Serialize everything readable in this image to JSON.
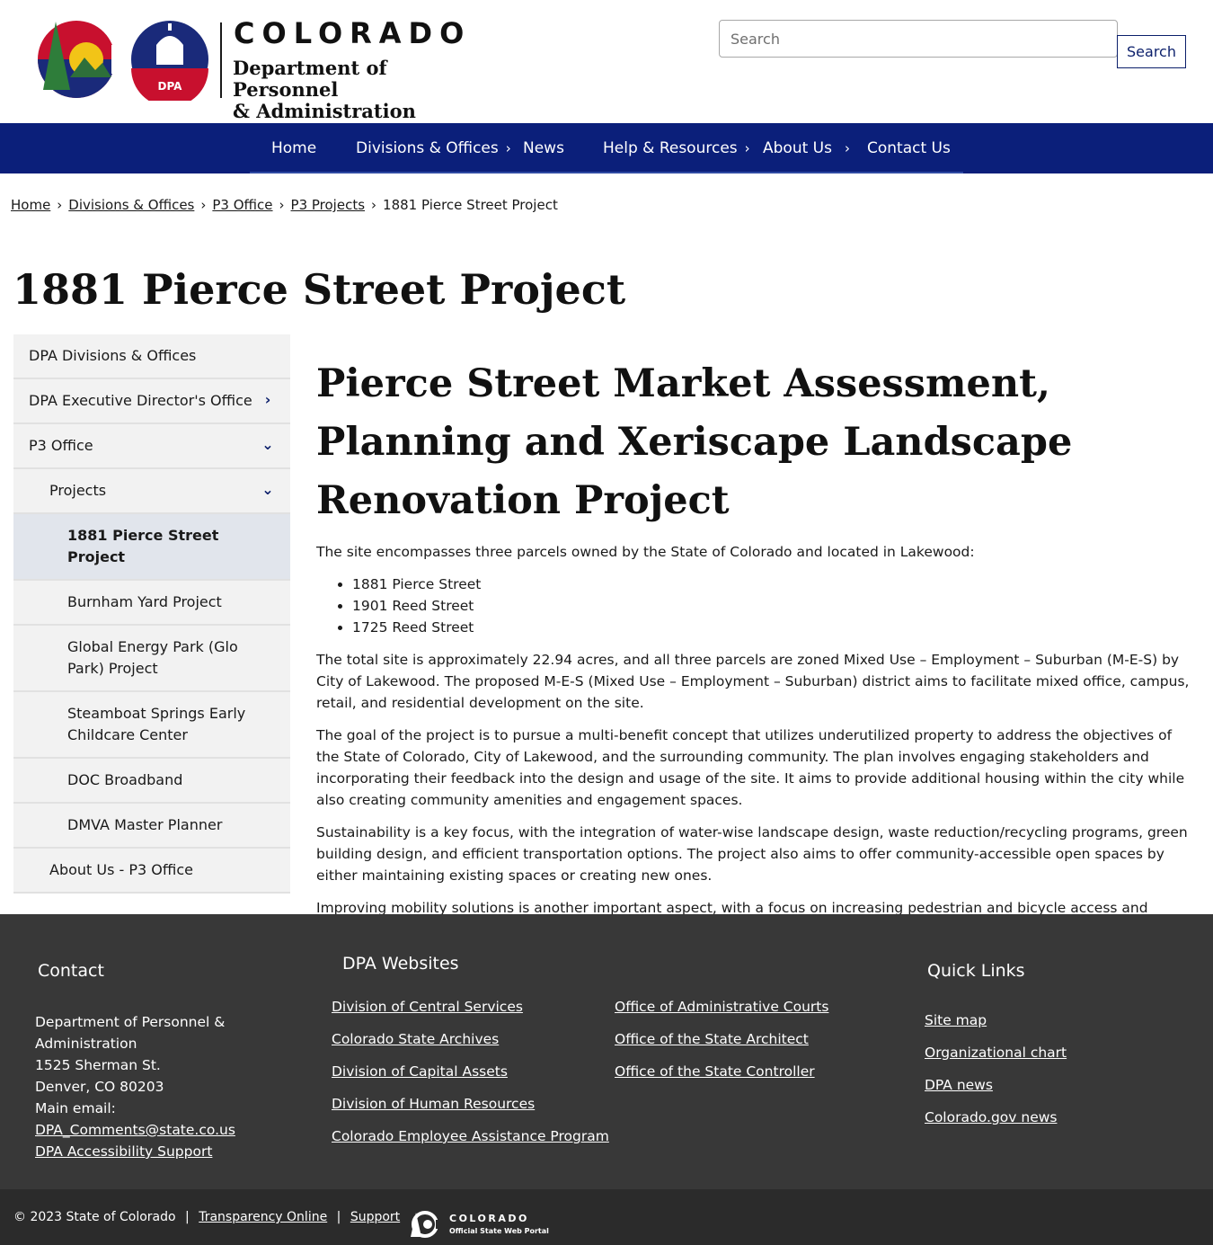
{
  "header": {
    "logo_colorado": "COLORADO",
    "logo_dept_line1": "Department of Personnel",
    "logo_dept_line2": "& Administration",
    "logo_badge": "DPA",
    "search_placeholder": "Search",
    "search_button": "Search"
  },
  "nav": {
    "items": [
      {
        "label": "Home",
        "has_chevron": false
      },
      {
        "label": "Divisions & Offices",
        "has_chevron": true
      },
      {
        "label": "News",
        "has_chevron": false
      },
      {
        "label": "Help & Resources",
        "has_chevron": true
      },
      {
        "label": "About Us",
        "has_chevron": true
      },
      {
        "label": "Contact Us",
        "has_chevron": false
      }
    ],
    "chevron": "›"
  },
  "breadcrumb": {
    "items": [
      "Home",
      "Divisions & Offices",
      "P3 Office",
      "P3 Projects"
    ],
    "current": "1881 Pierce Street Project",
    "separator": "›"
  },
  "page_title": "1881 Pierce Street Project",
  "sidebar": {
    "items": [
      {
        "label": "DPA Divisions & Offices",
        "chevron": ""
      },
      {
        "label": "DPA Executive Director's Office",
        "chevron": "right"
      },
      {
        "label": "P3 Office",
        "chevron": "down"
      },
      {
        "label": "Projects",
        "chevron": "down"
      },
      {
        "label": "1881 Pierce Street Project",
        "chevron": ""
      },
      {
        "label": "Burnham Yard Project",
        "chevron": ""
      },
      {
        "label": "Global Energy Park (Glo Park) Project",
        "chevron": ""
      },
      {
        "label": "Steamboat Springs Early Childcare Center",
        "chevron": ""
      },
      {
        "label": "DOC Broadband",
        "chevron": ""
      },
      {
        "label": "DMVA Master Planner",
        "chevron": ""
      },
      {
        "label": "About Us - P3 Office",
        "chevron": ""
      }
    ]
  },
  "main": {
    "heading": "Pierce Street Market Assessment, Planning and Xeriscape Landscape Renovation Project",
    "intro": "The site encompasses three parcels owned by the State of Colorado and located in Lakewood:",
    "parcels": [
      "1881 Pierce Street",
      "1901 Reed Street",
      "1725 Reed Street"
    ],
    "paragraphs": [
      "The total site is approximately 22.94 acres, and all three parcels are zoned Mixed Use – Employment – Suburban (M-E-S) by City of Lakewood. The proposed M-E-S (Mixed Use – Employment – Suburban) district aims to facilitate mixed office, campus, retail, and residential development on the site.",
      "The goal of the project is to pursue a multi-benefit concept that utilizes underutilized property to address the objectives of the State of Colorado, City of Lakewood, and the surrounding community. The plan involves engaging stakeholders and incorporating their feedback into the design and usage of the site. It aims to provide additional housing within the city while also creating community amenities and engagement spaces.",
      "Sustainability is a key focus, with the integration of water-wise landscape design, waste reduction/recycling programs, green building design, and efficient transportation options. The project also aims to offer community-accessible open spaces by either maintaining existing spaces or creating new ones.",
      "Improving mobility solutions is another important aspect, with a focus on increasing pedestrian and bicycle access and enhancing vehicular transportation. Moreover, the development is expected to contribute to increasing regional economic vitality."
    ]
  },
  "footer": {
    "contact_title": "Contact",
    "contact_lines": [
      "Department of Personnel &",
      "Administration",
      "1525 Sherman St.",
      "Denver, CO 80203",
      "Main email:"
    ],
    "contact_email": "DPA_Comments@state.co.us",
    "contact_access": "DPA Accessibility Support",
    "websites_title": "DPA Websites",
    "websites_col1": [
      "Division of Central Services",
      "Colorado State Archives",
      "Division of Capital Assets",
      "Division of Human Resources",
      "Colorado Employee Assistance Program"
    ],
    "websites_col2": [
      "Office of Administrative Courts",
      "Office of the State Architect",
      "Office of the State Controller"
    ],
    "quick_title": "Quick Links",
    "quick_links": [
      "Site map",
      "Organizational chart",
      "DPA news",
      "Colorado.gov news"
    ]
  },
  "subfooter": {
    "copyright": "© 2023 State of Colorado",
    "sep": "|",
    "transparency": "Transparency Online",
    "support": "Support",
    "portal_word": "COLORADO",
    "portal_sub": "Official State Web Portal"
  },
  "colors": {
    "nav_bg": "#0b1f7a",
    "footer_bg": "#383838",
    "subfooter_bg": "#2b2b2b",
    "sidebar_bg": "#f2f2f2",
    "sidebar_active": "#e1e5ec"
  }
}
